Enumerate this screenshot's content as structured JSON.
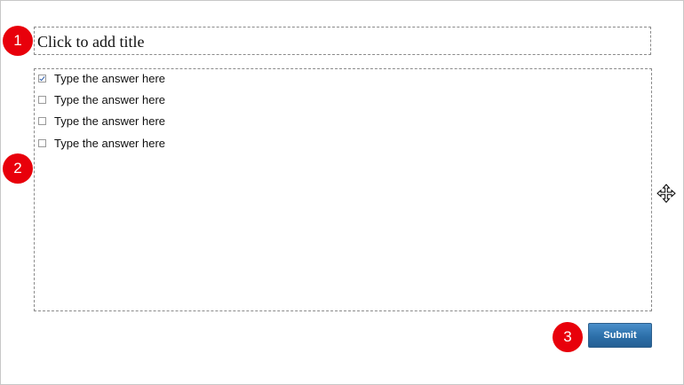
{
  "question": {
    "title_placeholder": "Click to add title"
  },
  "answers": [
    {
      "label": "Type the answer here",
      "checked": true
    },
    {
      "label": "Type the answer here",
      "checked": false
    },
    {
      "label": "Type the answer here",
      "checked": false
    },
    {
      "label": "Type the answer here",
      "checked": false
    }
  ],
  "actions": {
    "submit_label": "Submit"
  },
  "markers": [
    "1",
    "2",
    "3"
  ],
  "colors": {
    "marker_red": "#e8000b",
    "submit_blue": "#2c6fa9",
    "checkmark_blue": "#2a5aa8"
  },
  "icons": {
    "cursor": "move-cursor-icon"
  }
}
